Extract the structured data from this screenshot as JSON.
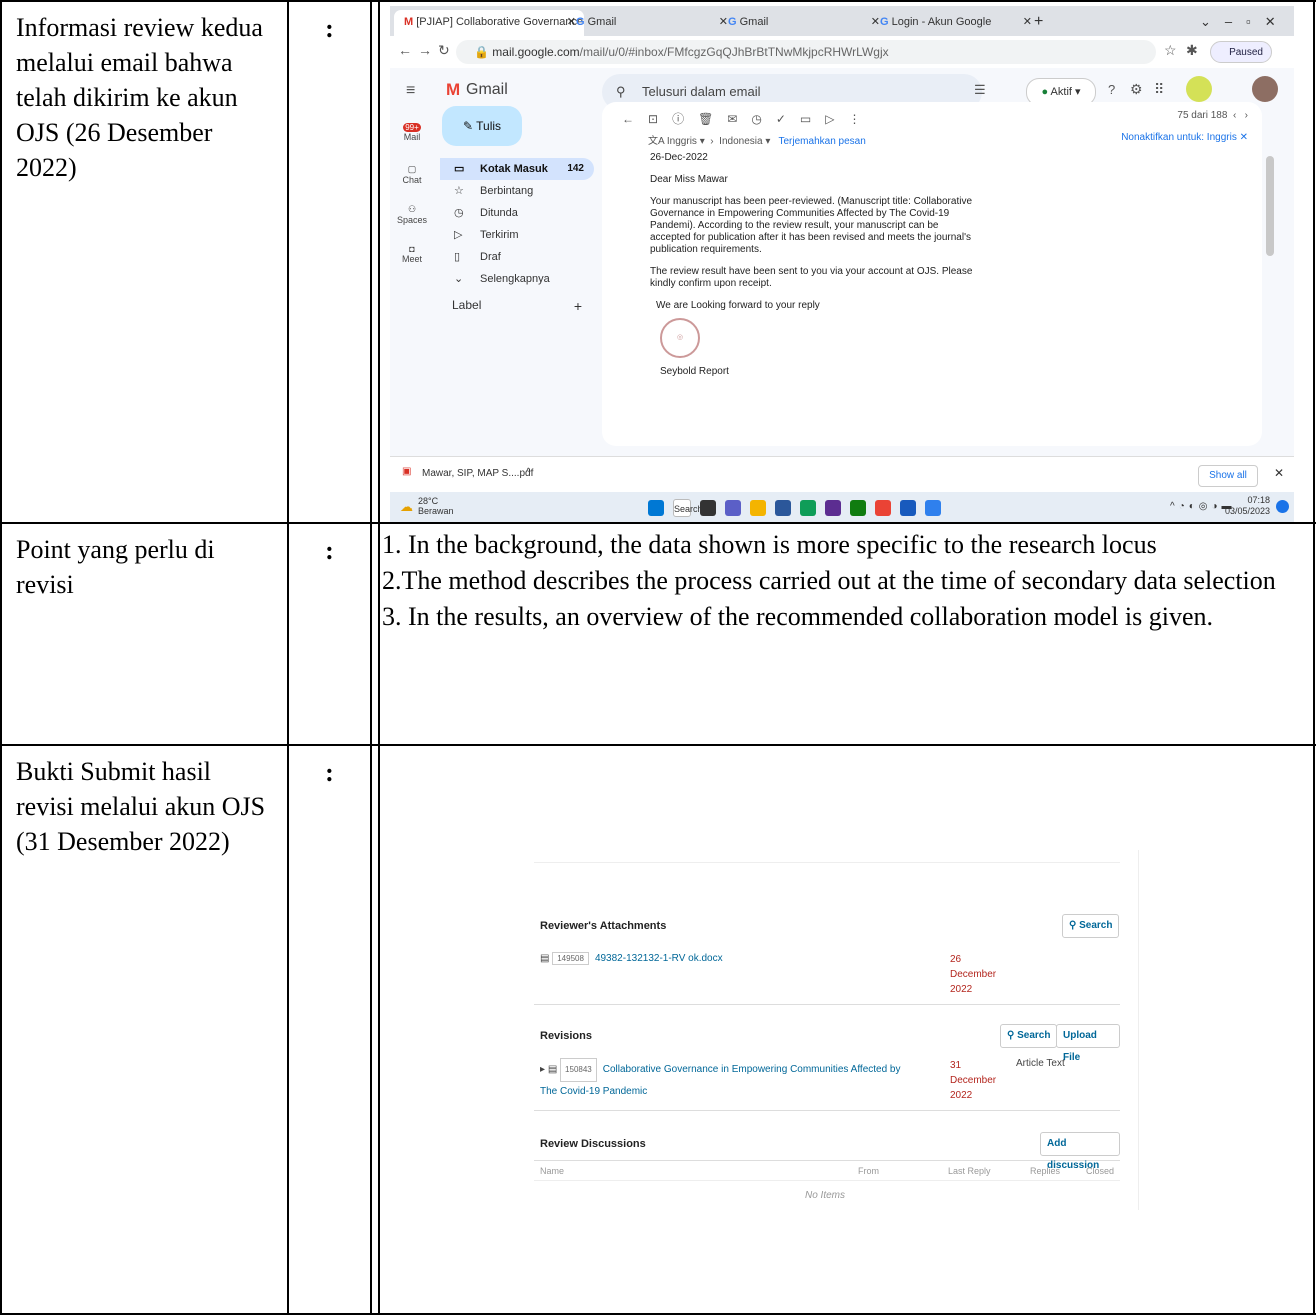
{
  "rows": [
    {
      "label": "Informasi review kedua melalui email bahwa telah dikirim ke akun OJS (26 Desember 2022)",
      "colon": ":"
    },
    {
      "label": "Point yang perlu di revisi",
      "colon": ":"
    },
    {
      "label": "Bukti Submit hasil revisi melalui akun OJS (31 Desember 2022)",
      "colon": ":"
    }
  ],
  "revision_points": [
    "1. In the background, the data shown is more specific to the research locus",
    " 2.The method describes the process carried out at the time of secondary data selection",
    " 3. In the results, an overview of the recommended collaboration model is given."
  ],
  "gmail": {
    "tabs": [
      "[PJIAP] Collaborative Governance",
      "Gmail",
      "Gmail",
      "Login - Akun Google"
    ],
    "url_host": "mail.google.com",
    "url_path": "/mail/u/0/#inbox/FMfcgzGqQJhBrBtTNwMkjpcRHWrLWgjx",
    "paused": "Paused",
    "app_name": "Gmail",
    "search_placeholder": "Telusuri dalam email",
    "status": "Aktif",
    "compose": "Tulis",
    "badge": "99+",
    "rail": [
      "Mail",
      "Chat",
      "Spaces",
      "Meet"
    ],
    "folders": [
      {
        "icon": "▭",
        "label": "Kotak Masuk",
        "count": "142"
      },
      {
        "icon": "☆",
        "label": "Berbintang",
        "count": ""
      },
      {
        "icon": "◷",
        "label": "Ditunda",
        "count": ""
      },
      {
        "icon": "▷",
        "label": "Terkirim",
        "count": ""
      },
      {
        "icon": "▯",
        "label": "Draf",
        "count": ""
      },
      {
        "icon": "⌄",
        "label": "Selengkapnya",
        "count": ""
      }
    ],
    "label_header": "Label",
    "pager": "75 dari 188",
    "translate_from": "Inggris",
    "translate_to": "Indonesia",
    "translate_link": "Terjemahkan pesan",
    "translate_off": "Nonaktifkan untuk: Inggris",
    "email_date": "26-Dec-2022",
    "greeting": "Dear Miss Mawar",
    "para1": "Your manuscript has been peer-reviewed. (Manuscript title: Collaborative Governance in Empowering Communities Affected by The Covid-19 Pandemi). According to the review result, your manuscript can be accepted for publication after it has been revised and meets the journal's publication requirements.",
    "para2": "The review result have been sent to you via your account at OJS. Please kindly confirm upon receipt.",
    "para3": "We are Looking forward to your reply",
    "signature": "Seybold Report",
    "download": "Mawar, SIP, MAP S....pdf",
    "show_all": "Show all",
    "weather_temp": "28°C",
    "weather_desc": "Berawan",
    "taskbar_search": "Search",
    "time": "07:18",
    "date": "03/05/2023"
  },
  "ojs": {
    "attachments_title": "Reviewer's Attachments",
    "search_btn": "Search",
    "att_file_id": "149508",
    "att_file_name": "49382-132132-1-RV ok.docx",
    "att_date": [
      "26",
      "December",
      "2022"
    ],
    "revisions_title": "Revisions",
    "upload_btn": "Upload File",
    "rev_file_id": "150843",
    "rev_file_name_1": "Collaborative Governance in Empowering Communities Affected by",
    "rev_file_name_2": "The Covid-19 Pandemic",
    "rev_date": [
      "31",
      "December",
      "2022"
    ],
    "rev_type": "Article Text",
    "discussions_title": "Review Discussions",
    "add_discussion": "Add discussion",
    "cols": [
      "Name",
      "From",
      "Last Reply",
      "Replies",
      "Closed"
    ],
    "no_items": "No Items"
  }
}
